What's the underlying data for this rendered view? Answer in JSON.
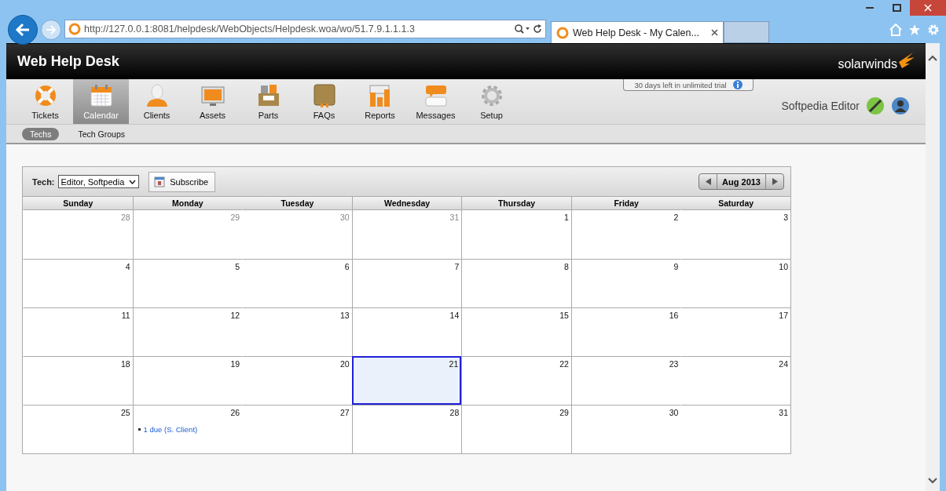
{
  "browser": {
    "address": "http://127.0.0.1:8081/helpdesk/WebObjects/Helpdesk.woa/wo/51.7.9.1.1.1.3",
    "tab_title": "Web Help Desk - My Calen..."
  },
  "app": {
    "title": "Web Help Desk",
    "logo": "solarwinds",
    "trial_notice": "30 days left in unlimited trial",
    "user": "Softpedia Editor"
  },
  "nav": [
    {
      "label": "Tickets",
      "selected": false
    },
    {
      "label": "Calendar",
      "selected": true
    },
    {
      "label": "Clients",
      "selected": false
    },
    {
      "label": "Assets",
      "selected": false
    },
    {
      "label": "Parts",
      "selected": false
    },
    {
      "label": "FAQs",
      "selected": false
    },
    {
      "label": "Reports",
      "selected": false
    },
    {
      "label": "Messages",
      "selected": false
    },
    {
      "label": "Setup",
      "selected": false
    }
  ],
  "subnav": [
    {
      "label": "Techs",
      "selected": true
    },
    {
      "label": "Tech Groups",
      "selected": false
    }
  ],
  "calendar": {
    "tech_label": "Tech:",
    "tech_value": "Editor, Softpedia",
    "subscribe": "Subscribe",
    "month": "Aug 2013",
    "weekdays": [
      "Sunday",
      "Monday",
      "Tuesday",
      "Wednesday",
      "Thursday",
      "Friday",
      "Saturday"
    ],
    "weeks": [
      [
        {
          "day": "28",
          "in_month": false,
          "selected": false
        },
        {
          "day": "29",
          "in_month": false,
          "selected": false
        },
        {
          "day": "30",
          "in_month": false,
          "selected": false
        },
        {
          "day": "31",
          "in_month": false,
          "selected": false
        },
        {
          "day": "1",
          "in_month": true,
          "selected": false
        },
        {
          "day": "2",
          "in_month": true,
          "selected": false
        },
        {
          "day": "3",
          "in_month": true,
          "selected": false
        }
      ],
      [
        {
          "day": "4",
          "in_month": true,
          "selected": false
        },
        {
          "day": "5",
          "in_month": true,
          "selected": false
        },
        {
          "day": "6",
          "in_month": true,
          "selected": false
        },
        {
          "day": "7",
          "in_month": true,
          "selected": false
        },
        {
          "day": "8",
          "in_month": true,
          "selected": false
        },
        {
          "day": "9",
          "in_month": true,
          "selected": false
        },
        {
          "day": "10",
          "in_month": true,
          "selected": false
        }
      ],
      [
        {
          "day": "11",
          "in_month": true,
          "selected": false
        },
        {
          "day": "12",
          "in_month": true,
          "selected": false
        },
        {
          "day": "13",
          "in_month": true,
          "selected": false
        },
        {
          "day": "14",
          "in_month": true,
          "selected": false
        },
        {
          "day": "15",
          "in_month": true,
          "selected": false
        },
        {
          "day": "16",
          "in_month": true,
          "selected": false
        },
        {
          "day": "17",
          "in_month": true,
          "selected": false
        }
      ],
      [
        {
          "day": "18",
          "in_month": true,
          "selected": false
        },
        {
          "day": "19",
          "in_month": true,
          "selected": false
        },
        {
          "day": "20",
          "in_month": true,
          "selected": false
        },
        {
          "day": "21",
          "in_month": true,
          "selected": true
        },
        {
          "day": "22",
          "in_month": true,
          "selected": false
        },
        {
          "day": "23",
          "in_month": true,
          "selected": false
        },
        {
          "day": "24",
          "in_month": true,
          "selected": false
        }
      ],
      [
        {
          "day": "25",
          "in_month": true,
          "selected": false
        },
        {
          "day": "26",
          "in_month": true,
          "selected": false,
          "events": [
            "1 due (S. Client)"
          ]
        },
        {
          "day": "27",
          "in_month": true,
          "selected": false
        },
        {
          "day": "28",
          "in_month": true,
          "selected": false
        },
        {
          "day": "29",
          "in_month": true,
          "selected": false
        },
        {
          "day": "30",
          "in_month": true,
          "selected": false
        },
        {
          "day": "31",
          "in_month": true,
          "selected": false
        }
      ]
    ]
  }
}
